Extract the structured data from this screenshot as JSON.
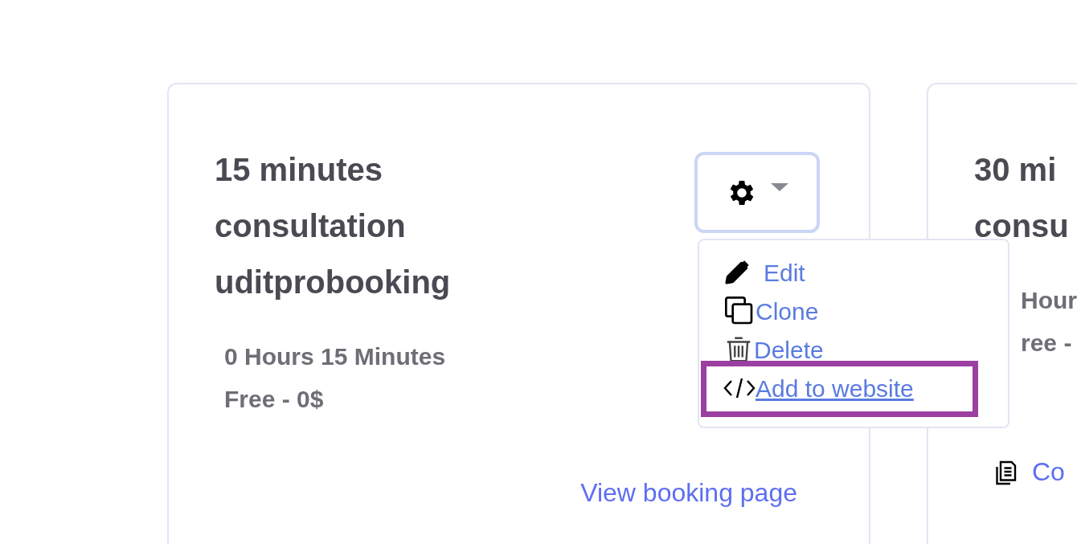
{
  "cards": [
    {
      "title_lines": [
        "15 minutes",
        "consultation",
        "uditprobooking"
      ],
      "details": [
        "0 Hours 15 Minutes",
        "Free - 0$"
      ],
      "link": {
        "kind": "view",
        "label": "View booking page"
      },
      "settings_menu": {
        "expanded": true,
        "items": [
          {
            "kind": "edit",
            "label": "Edit",
            "highlighted": false
          },
          {
            "kind": "clone",
            "label": "Clone",
            "highlighted": false
          },
          {
            "kind": "delete",
            "label": "Delete",
            "highlighted": false
          },
          {
            "kind": "embed",
            "label": "Add to website",
            "highlighted": true
          }
        ]
      }
    },
    {
      "title_lines": [
        "30 mi",
        "consu"
      ],
      "details": [
        "Hour",
        "ree -"
      ],
      "link": {
        "kind": "copy",
        "label": "Co"
      }
    }
  ]
}
